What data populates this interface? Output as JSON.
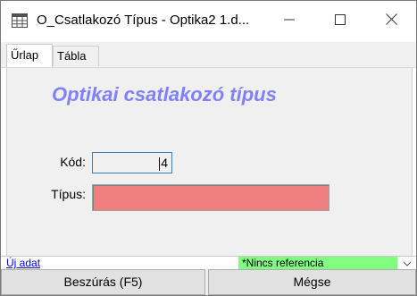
{
  "window": {
    "title": "O_Csatlakozó Típus - Optika2 1.d...",
    "icon": "datasheet-icon"
  },
  "controls": {
    "minimize": "minimize-icon",
    "maximize": "maximize-icon",
    "close": "close-icon"
  },
  "tabs": [
    {
      "label": "Űrlap",
      "active": true
    },
    {
      "label": "Tábla",
      "active": false
    }
  ],
  "form": {
    "title": "Optikai csatlakozó típus",
    "fields": {
      "kod": {
        "label": "Kód:",
        "value": "4"
      },
      "tipus": {
        "label": "Típus:",
        "value": ""
      }
    },
    "colors": {
      "title": "#8080ff",
      "tipus_background": "#f08080",
      "background": "#f0f0f0"
    }
  },
  "status": {
    "new_record": "Új adat",
    "reference": "*Nincs referencia",
    "reference_color": "#80ff80"
  },
  "buttons": {
    "insert": "Beszúrás (F5)",
    "cancel": "Mégse"
  }
}
